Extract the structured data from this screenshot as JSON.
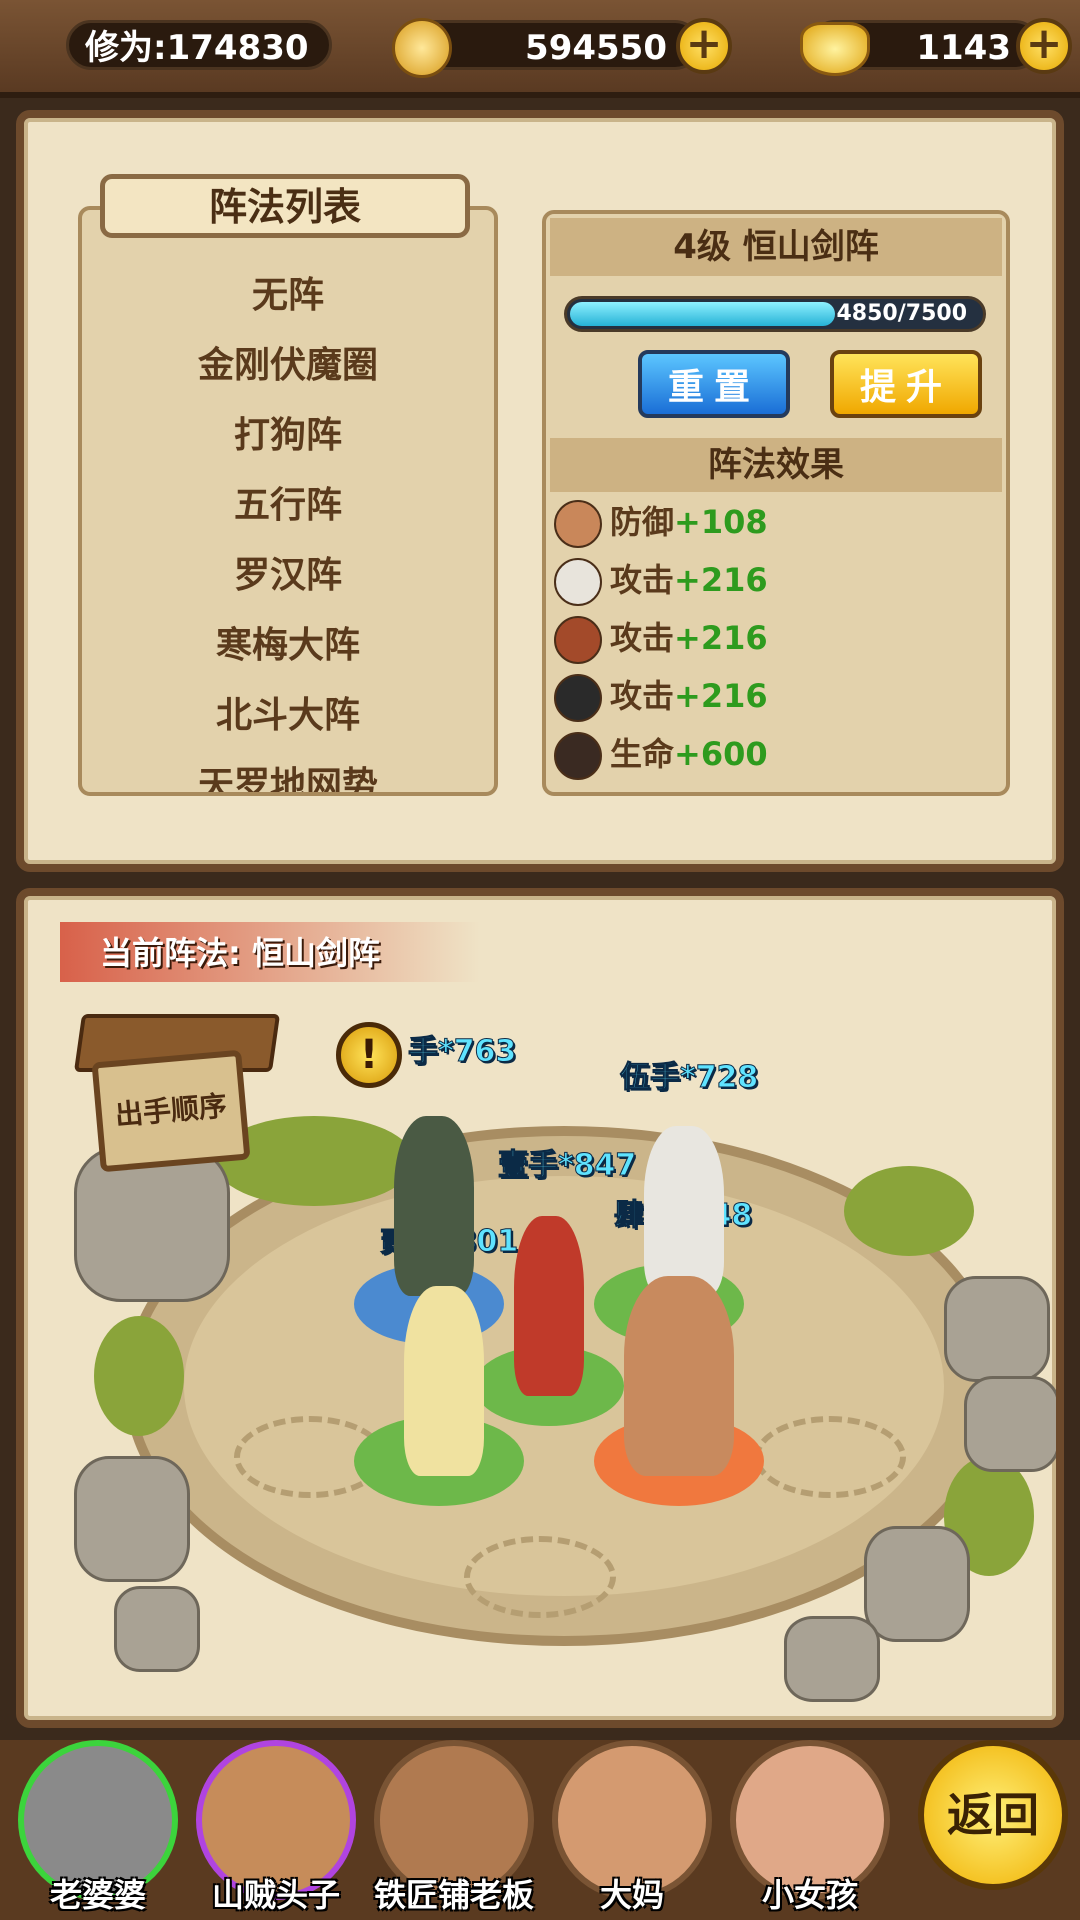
{
  "topbar": {
    "cultivation": "修为:174830",
    "coins": "594550",
    "gold": "1143",
    "plus_label": "+"
  },
  "formation_list": {
    "title": "阵法列表",
    "items": [
      "无阵",
      "金刚伏魔圈",
      "打狗阵",
      "五行阵",
      "罗汉阵",
      "寒梅大阵",
      "北斗大阵",
      "天罗地网势"
    ]
  },
  "formation_detail": {
    "title": "4级 恒山剑阵",
    "progress_text": "4850/7500",
    "progress": 0.647,
    "reset_label": "重置",
    "upgrade_label": "提升",
    "effects_title": "阵法效果",
    "effects": [
      {
        "stat": "防御",
        "value": "+108"
      },
      {
        "stat": "攻击",
        "value": "+216"
      },
      {
        "stat": "攻击",
        "value": "+216"
      },
      {
        "stat": "攻击",
        "value": "+216"
      },
      {
        "stat": "生命",
        "value": "+600"
      }
    ]
  },
  "battlefield": {
    "current_label": "当前阵法: 恒山剑阵",
    "sign_label": "出手顺序",
    "alert_icon": "exclamation-icon",
    "hands": [
      "手*763",
      "伍手*728",
      "壹手*847",
      "肆手*748",
      "贰手*801"
    ]
  },
  "bottom": {
    "heroes": [
      "老婆婆",
      "山贼头子",
      "铁匠铺老板",
      "大妈",
      "小女孩"
    ],
    "back_label": "返回"
  }
}
